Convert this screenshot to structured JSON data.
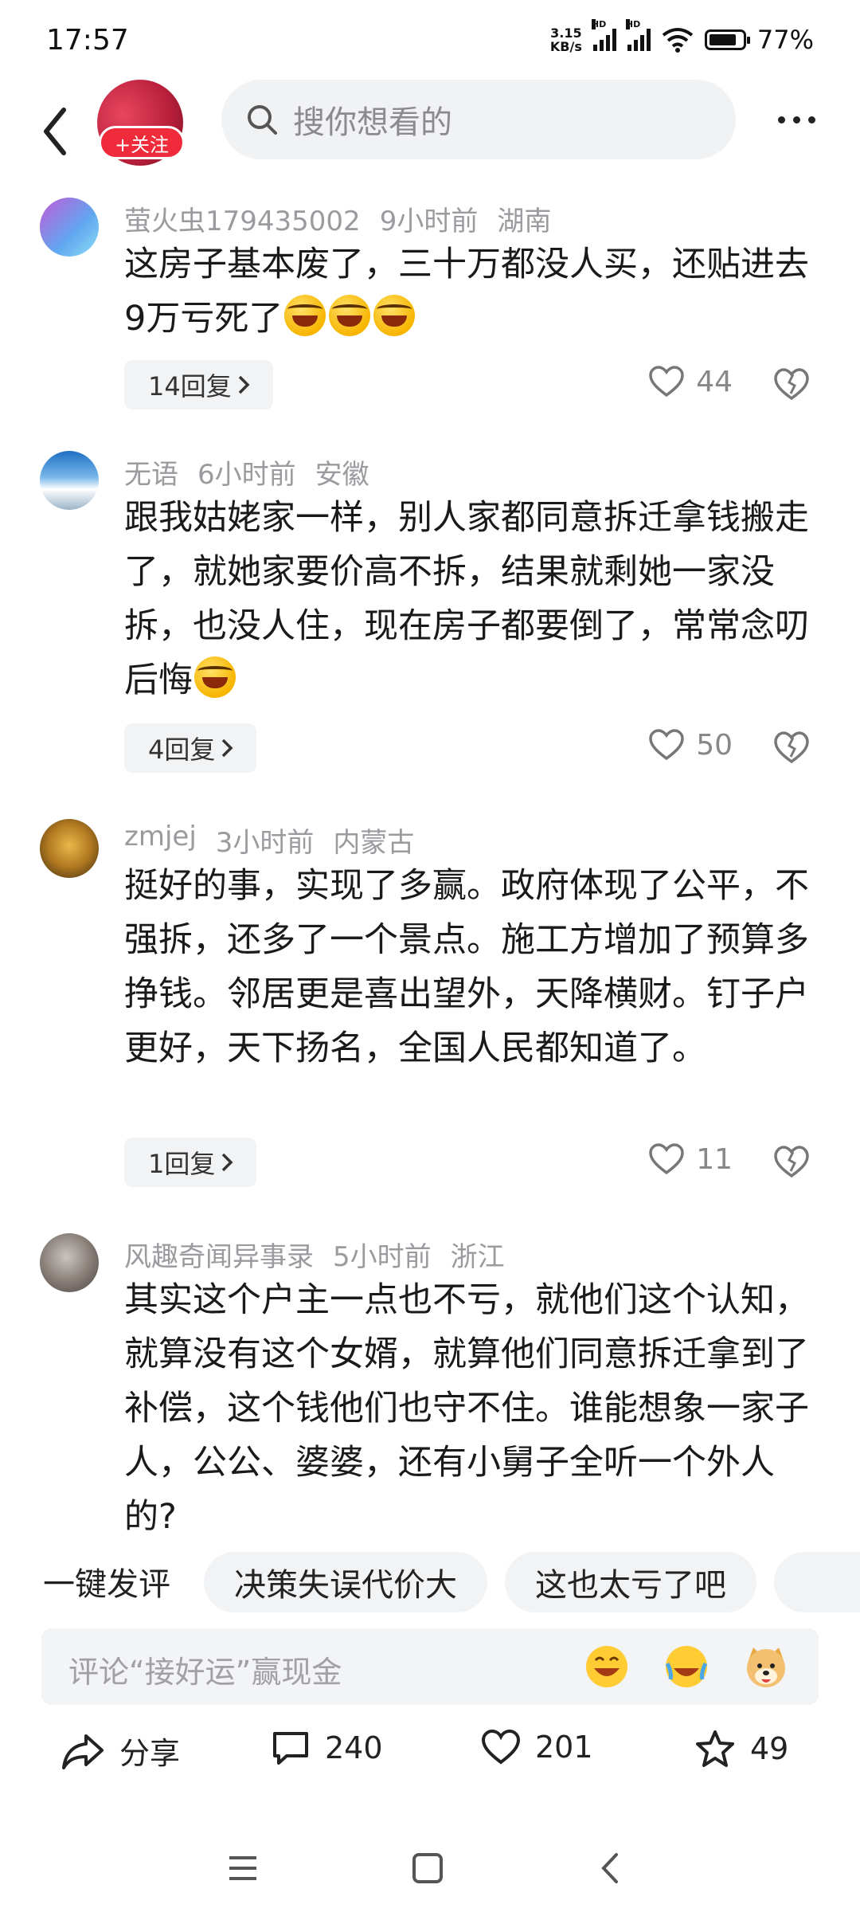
{
  "status_bar": {
    "time": "17:57",
    "net_speed_value": "3.15",
    "net_speed_unit": "KB/s",
    "signal_label": "HD",
    "battery": "77%"
  },
  "header": {
    "follow_label": "+关注",
    "search_placeholder": "搜你想看的"
  },
  "comments": [
    {
      "user": "萤火虫179435002",
      "time": "9小时前",
      "location": "湖南",
      "text": "这房子基本废了，三十万都没人买，还贴进去9万亏死了",
      "emoji_count": 3,
      "replies": "14回复",
      "likes": "44"
    },
    {
      "user": "无语",
      "time": "6小时前",
      "location": "安徽",
      "text": "跟我姑姥家一样，别人家都同意拆迁拿钱搬走了，就她家要价高不拆，结果就剩她一家没拆，也没人住，现在房子都要倒了，常常念叨后悔",
      "emoji_count": 1,
      "replies": "4回复",
      "likes": "50"
    },
    {
      "user": "zmjej",
      "time": "3小时前",
      "location": "内蒙古",
      "text": "挺好的事，实现了多赢。政府体现了公平，不强拆，还多了一个景点。施工方增加了预算多挣钱。邻居更是喜出望外，天降横财。钉子户更好，天下扬名，全国人民都知道了。",
      "emoji_count": 0,
      "replies": "1回复",
      "likes": "11"
    },
    {
      "user": "风趣奇闻异事录",
      "time": "5小时前",
      "location": "浙江",
      "text": "其实这个户主一点也不亏，就他们这个认知，就算没有这个女婿，就算他们同意拆迁拿到了补偿，这个钱他们也守不住。谁能想象一家子人，公公、婆婆，还有小舅子全听一个外人的?",
      "emoji_count": 0
    }
  ],
  "quick_reply": {
    "label": "一键发评",
    "chips": [
      "决策失误代价大",
      "这也太亏了吧"
    ]
  },
  "comment_input": {
    "placeholder": "评论“接好运”赢现金"
  },
  "actions": {
    "share": "分享",
    "comments": "240",
    "likes": "201",
    "favorites": "49"
  }
}
